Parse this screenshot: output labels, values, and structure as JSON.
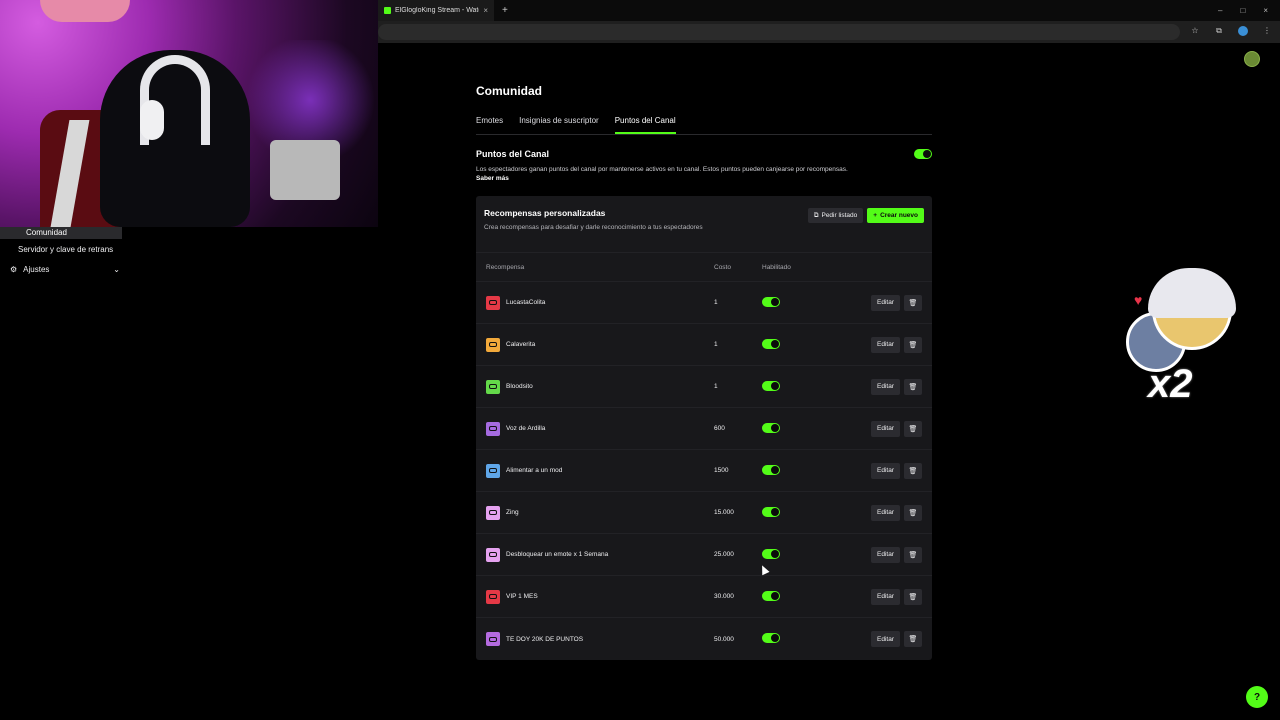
{
  "browser": {
    "tab_title": "ElGlogloKing Stream - Watch Li",
    "tab_close": "×",
    "new_tab": "+",
    "window_controls": [
      "–",
      "□",
      "×"
    ]
  },
  "sidebar": {
    "active_item": "Comunidad",
    "items": [
      "Servidor y clave de retrans",
      "Ajustes"
    ]
  },
  "page": {
    "title": "Comunidad",
    "tabs": [
      "Emotes",
      "Insignias de suscriptor",
      "Puntos del Canal"
    ],
    "active_tab": "Puntos del Canal"
  },
  "channel_points": {
    "title": "Puntos del Canal",
    "enabled": true,
    "description": "Los espectadores ganan puntos del canal por mantenerse activos en tu canal. Estos puntos pueden canjearse por recompensas.",
    "learn_more": "Saber más"
  },
  "rewards": {
    "title": "Recompensas personalizadas",
    "subtitle": "Crea recompensas para desafiar y darle reconocimiento a tus espectadores",
    "request_list_label": "Pedir listado",
    "create_label": "Crear nuevo",
    "columns": {
      "name": "Recompensa",
      "cost": "Costo",
      "enabled": "Habilitado"
    },
    "edit_label": "Editar",
    "items": [
      {
        "name": "LucastaColita",
        "cost": "1",
        "color": "#e53946",
        "enabled": true
      },
      {
        "name": "Calaverita",
        "cost": "1",
        "color": "#f2a93b",
        "enabled": true
      },
      {
        "name": "Bloodsito",
        "cost": "1",
        "color": "#64d94a",
        "enabled": true
      },
      {
        "name": "Voz de Ardilla",
        "cost": "600",
        "color": "#a56be0",
        "enabled": true
      },
      {
        "name": "Alimentar a un mod",
        "cost": "1500",
        "color": "#5fa6e8",
        "enabled": true
      },
      {
        "name": "Zing",
        "cost": "15.000",
        "color": "#e5a2f0",
        "enabled": true
      },
      {
        "name": "Desbloquear un emote x 1 Semana",
        "cost": "25.000",
        "color": "#e5a2f0",
        "enabled": true
      },
      {
        "name": "VIP 1 MES",
        "cost": "30.000",
        "color": "#e53946",
        "enabled": true
      },
      {
        "name": "TE DOY 20K DE PUNTOS",
        "cost": "50.000",
        "color": "#b46be0",
        "enabled": true
      }
    ]
  },
  "overlay": {
    "sticker_text": "x2"
  },
  "colors": {
    "accent": "#53fc18",
    "background": "#000000",
    "card": "#18181b"
  }
}
